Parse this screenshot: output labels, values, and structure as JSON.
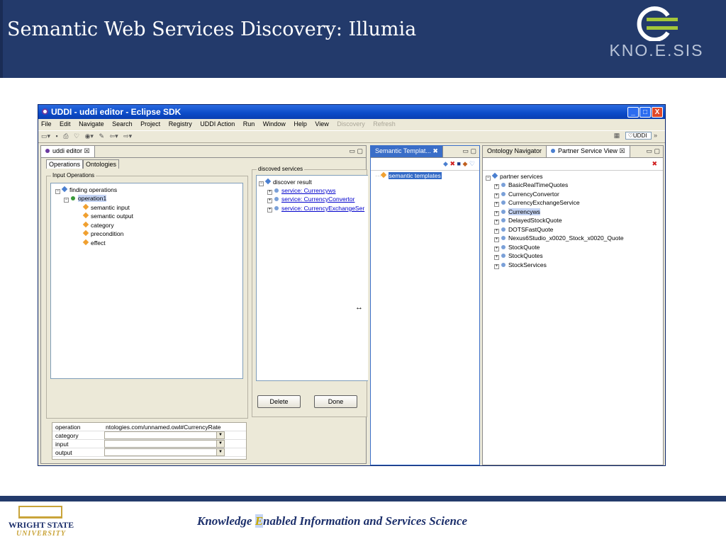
{
  "slide": {
    "title": "Semantic Web Services Discovery: Illumia",
    "logo_text": "KNO.E.SIS",
    "footer": {
      "pre": "Knowledge ",
      "hl": "E",
      "post": "nabled Information and Services Science"
    },
    "university": {
      "name": "WRIGHT STATE",
      "sub": "UNIVERSITY"
    }
  },
  "window": {
    "title": "UDDI - uddi editor - Eclipse SDK",
    "controls": {
      "minimize": "_",
      "maximize": "□",
      "close": "X"
    },
    "menu": [
      "File",
      "Edit",
      "Navigate",
      "Search",
      "Project",
      "Registry",
      "UDDI Action",
      "Run",
      "Window",
      "Help",
      "View"
    ],
    "menu_disabled": [
      "Discovery",
      "Refresh"
    ],
    "perspective_label": "UDDI",
    "toolbar_more": "»"
  },
  "editor": {
    "tab_label": "uddi editor",
    "tab_close": "☒",
    "inner_tabs": [
      "Operations",
      "Ontologies"
    ],
    "input_group_label": "Input Operations",
    "tree": {
      "root": "finding operations",
      "child": "operation1",
      "leaves": [
        "semantic input",
        "semantic output",
        "category",
        "precondition",
        "effect"
      ]
    },
    "properties": [
      {
        "key": "operation",
        "value": "ntologies.com/unnamed.owl#CurrencyRate"
      },
      {
        "key": "category",
        "value": ""
      },
      {
        "key": "input",
        "value": ""
      },
      {
        "key": "output",
        "value": ""
      }
    ],
    "discovered_label": "discoved services",
    "discover_root": "discover result",
    "services": [
      "service: Currencyws",
      "service: CurrencyConvertor",
      "service: CurrencyExchangeSer"
    ],
    "delete_label": "Delete",
    "done_label": "Done",
    "resize_cursor": "↔"
  },
  "templates_view": {
    "tab_label": "Semantic Templat...",
    "close": "✖",
    "root": "semantic templates"
  },
  "partner_view": {
    "tab_ontology": "Ontology Navigator",
    "tab_partner": "Partner Service View",
    "tab_close": "☒",
    "root": "partner services",
    "items": [
      "BasicRealTimeQuotes",
      "CurrencyConvertor",
      "CurrencyExchangeService",
      "Currencyws",
      "DelayedStockQuote",
      "DOTSFastQuote",
      "Nexus6Studio_x0020_Stock_x0020_Quote",
      "StockQuote",
      "StockQuotes",
      "StockServices"
    ],
    "selected_item": "Currencyws"
  },
  "colors": {
    "header_bg": "#233a6b",
    "accent_gold": "#c9a900",
    "selection": "#3169c6"
  }
}
